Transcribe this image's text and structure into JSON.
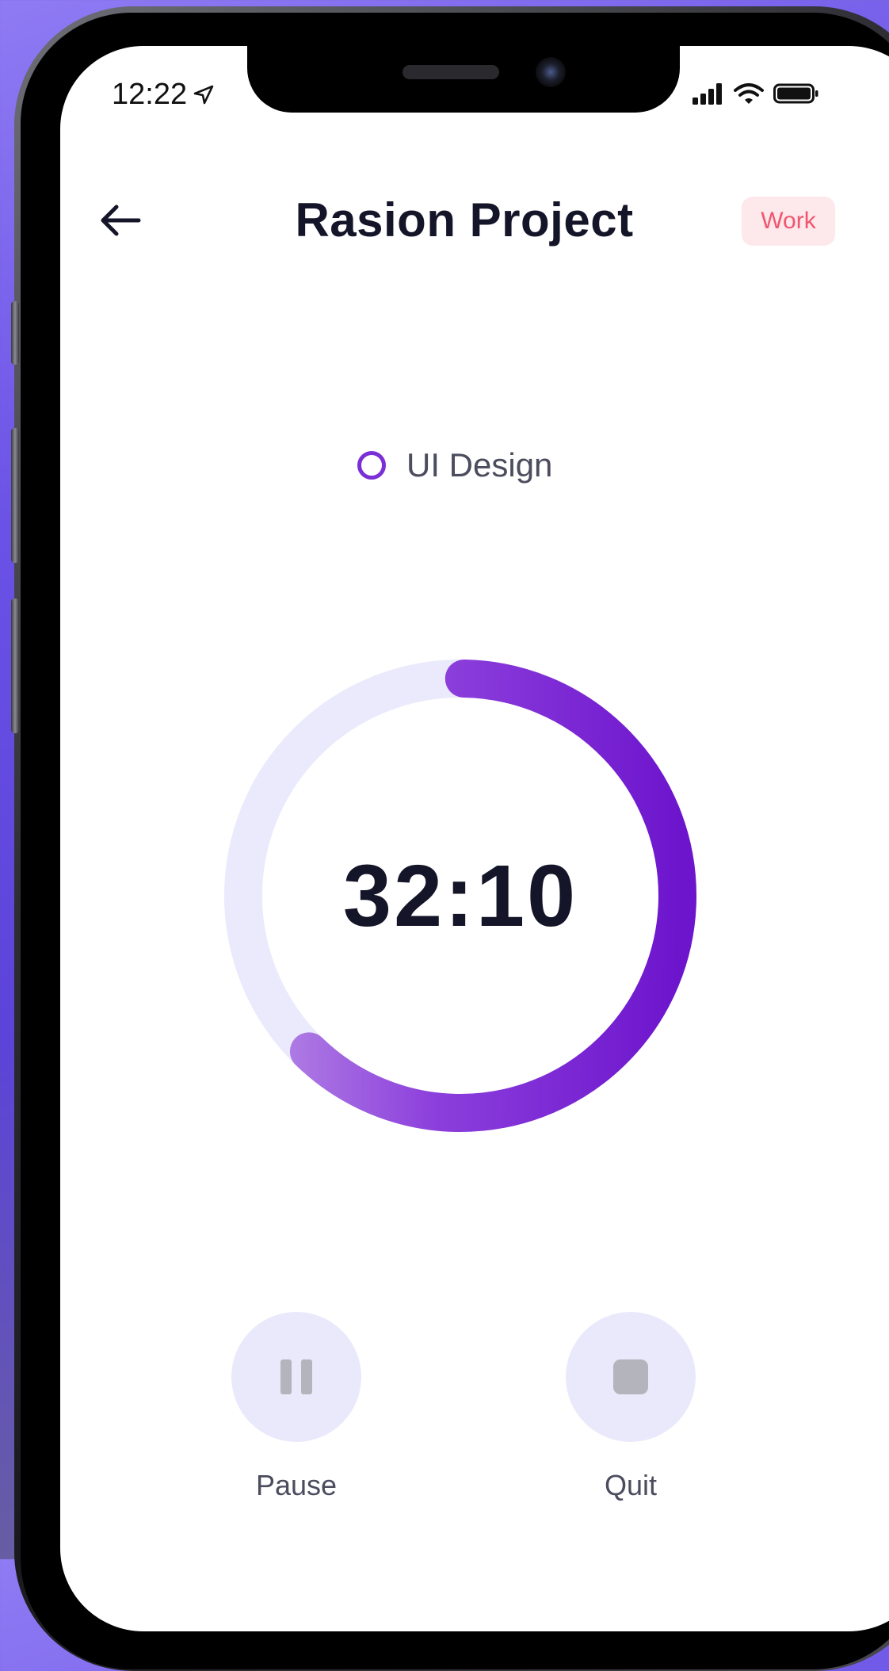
{
  "status_bar": {
    "time": "12:22"
  },
  "header": {
    "title": "Rasion Project",
    "badge": "Work"
  },
  "task": {
    "label": "UI Design"
  },
  "timer": {
    "display": "32:10",
    "progress": 0.62
  },
  "controls": {
    "pause_label": "Pause",
    "quit_label": "Quit"
  },
  "colors": {
    "accent": "#7b2fd6",
    "track": "#eaeafc",
    "badge_bg": "#fde8ec",
    "badge_text": "#f0566e"
  },
  "icons": {
    "back": "arrow-left-icon",
    "location": "location-arrow-icon",
    "signal": "signal-icon",
    "wifi": "wifi-icon",
    "battery": "battery-icon",
    "pause": "pause-icon",
    "stop": "stop-icon"
  }
}
